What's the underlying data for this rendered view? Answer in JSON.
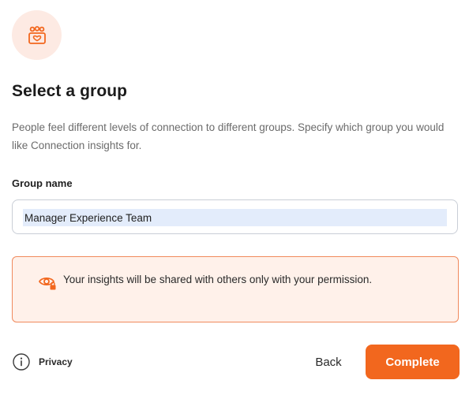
{
  "header": {
    "icon": "group-icon",
    "accent_color": "#f2671e",
    "icon_background": "#fdeae3"
  },
  "title": "Select a group",
  "description": "People feel different levels of connection to different groups. Specify which group you would like Connection insights for.",
  "group_field": {
    "label": "Group name",
    "value": "Manager Experience Team"
  },
  "notice": {
    "icon": "eye-lock-icon",
    "text": "Your insights will be shared with others only with your permission.",
    "border_color": "#f08a5d",
    "background_color": "#fff1ea"
  },
  "footer": {
    "privacy_icon": "info-icon",
    "privacy_label": "Privacy",
    "back_label": "Back",
    "complete_label": "Complete"
  }
}
